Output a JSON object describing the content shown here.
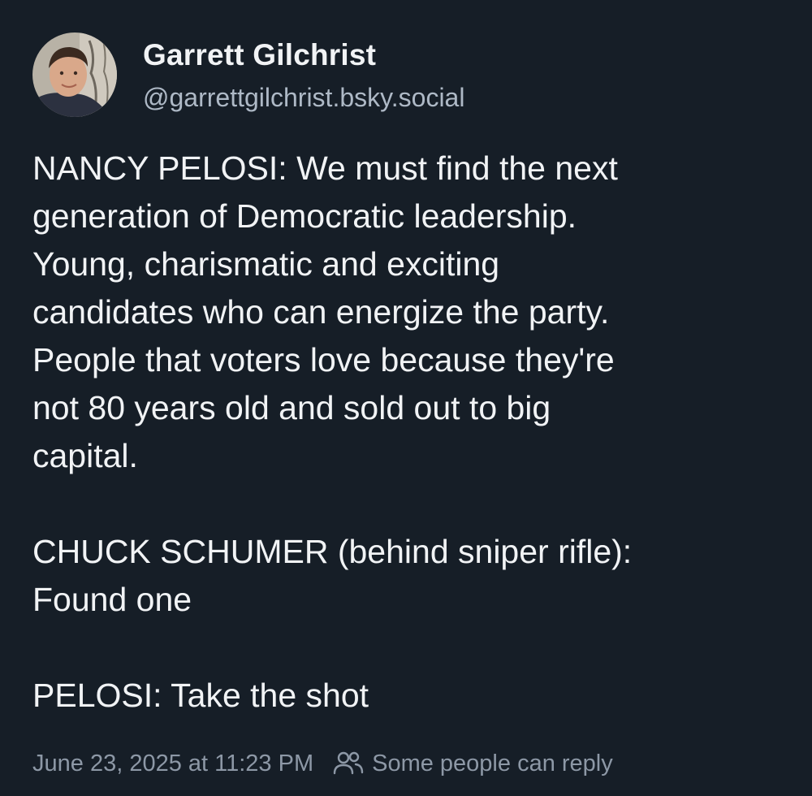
{
  "post": {
    "author": {
      "display_name": "Garrett Gilchrist",
      "handle": "@garrettgilchrist.bsky.social",
      "avatar_icon": "user-avatar-photo"
    },
    "paragraphs": [
      {
        "lines": [
          "NANCY PELOSI: We must find the next",
          "generation of Democratic leadership.",
          "Young, charismatic and exciting",
          "candidates who can energize the party.",
          "People that voters love because they're",
          "not 80 years old and sold out to big",
          "capital."
        ]
      },
      {
        "lines": [
          "CHUCK SCHUMER (behind sniper rifle):",
          "Found one"
        ]
      },
      {
        "lines": [
          "PELOSI: Take the shot"
        ]
      }
    ],
    "timestamp": "June 23, 2025 at 11:23 PM",
    "reply_setting": "Some people can reply",
    "reply_icon": "people-icon"
  },
  "colors": {
    "background": "#161e27",
    "text_primary": "#f1f3f5",
    "text_secondary": "#aeb9c6",
    "text_meta": "#8d98a6"
  }
}
